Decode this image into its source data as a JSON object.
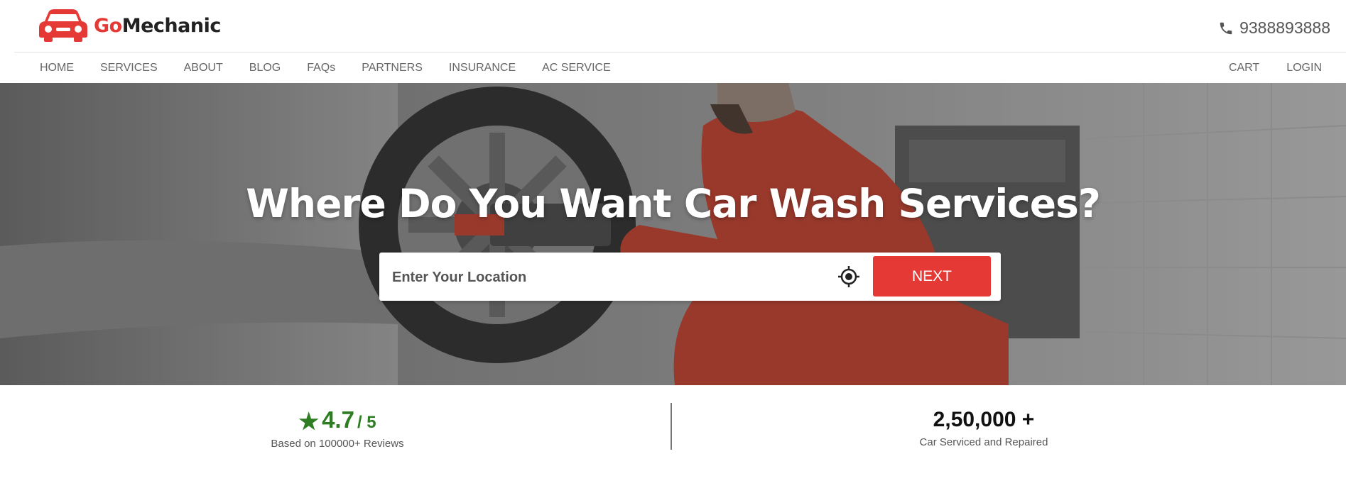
{
  "brand": {
    "prefix": "Go",
    "suffix": "Mechanic",
    "accent_color": "#e53935",
    "logo_icon": "car-icon"
  },
  "contact": {
    "phone_icon": "phone-icon",
    "phone": "9388893888"
  },
  "nav": {
    "left": [
      "HOME",
      "SERVICES",
      "ABOUT",
      "BLOG",
      "FAQs",
      "PARTNERS",
      "INSURANCE",
      "AC SERVICE"
    ],
    "right": [
      "CART",
      "LOGIN"
    ]
  },
  "hero": {
    "title": "Where Do You Want Car Wash Services?",
    "search": {
      "placeholder": "Enter Your Location",
      "value": "",
      "locate_icon": "crosshair-icon"
    },
    "next_label": "NEXT"
  },
  "stats": {
    "rating": {
      "star_icon": "star-icon",
      "value": "4.7",
      "out_of": "/ 5",
      "caption": "Based on 100000+ Reviews",
      "color": "#2e7d22"
    },
    "serviced": {
      "value": "2,50,000 +",
      "caption": "Car Serviced and Repaired"
    }
  }
}
